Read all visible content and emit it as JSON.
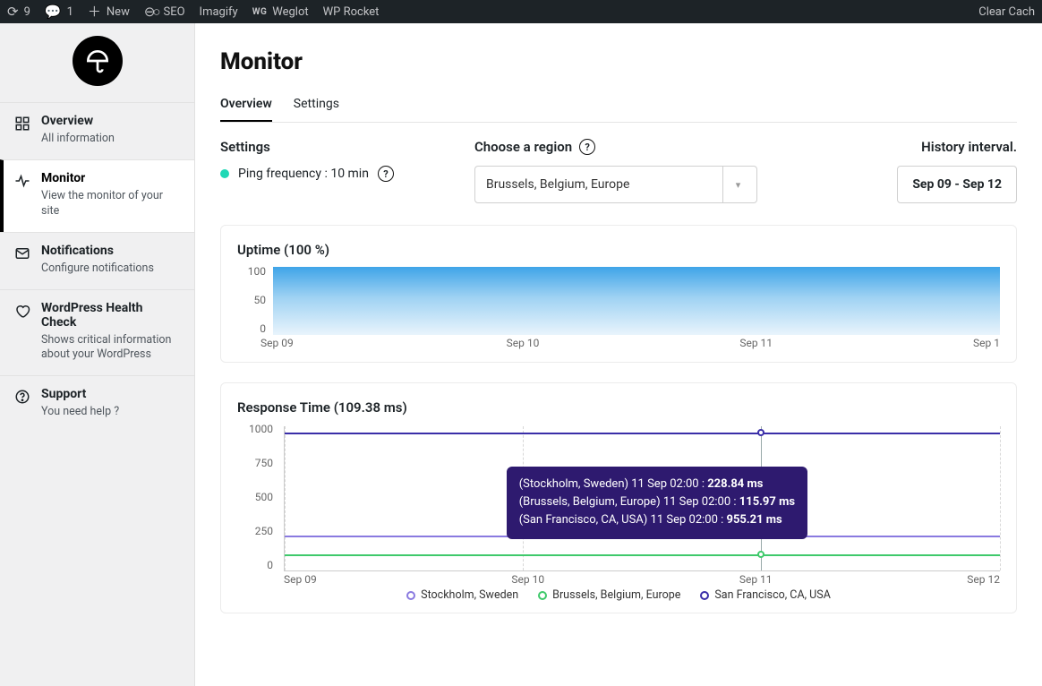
{
  "adminbar": {
    "updates_count": "9",
    "comments_count": "1",
    "new_label": "New",
    "items": [
      "SEO",
      "Imagify",
      "Weglot",
      "WP Rocket"
    ],
    "clear_cache": "Clear Cach"
  },
  "sidebar": {
    "items": [
      {
        "label": "Overview",
        "desc": "All information"
      },
      {
        "label": "Monitor",
        "desc": "View the monitor of your site"
      },
      {
        "label": "Notifications",
        "desc": "Configure notifications"
      },
      {
        "label": "WordPress Health Check",
        "desc": "Shows critical information about your WordPress"
      },
      {
        "label": "Support",
        "desc": "You need help ?"
      }
    ]
  },
  "page": {
    "title": "Monitor"
  },
  "tabs": {
    "overview": "Overview",
    "settings": "Settings"
  },
  "controls": {
    "settings_label": "Settings",
    "ping_text": "Ping frequency : 10 min",
    "region_label": "Choose a region",
    "region_value": "Brussels, Belgium, Europe",
    "history_label": "History interval.",
    "date_range": "Sep 09 - Sep 12"
  },
  "uptime": {
    "title": "Uptime (100 %)",
    "ylabels": [
      "100",
      "50",
      "0"
    ],
    "xlabels": [
      "Sep 09",
      "Sep 10",
      "Sep 11",
      "Sep 1"
    ]
  },
  "response": {
    "title": "Response Time (109.38 ms)",
    "ylabels": [
      "1000",
      "750",
      "500",
      "250",
      "0"
    ],
    "xlabels": [
      "Sep 09",
      "Sep 10",
      "Sep 11",
      "Sep 12"
    ],
    "legend": [
      "Stockholm, Sweden",
      "Brussels, Belgium, Europe",
      "San Francisco, CA, USA"
    ],
    "colors": {
      "stockholm": "#8a7ae0",
      "brussels": "#3fc96b",
      "sanfrancisco": "#3a2ea8"
    },
    "tooltip": {
      "l1_loc": "(Stockholm, Sweden) 11 Sep 02:00 : ",
      "l1_val": "228.84 ms",
      "l2_loc": "(Brussels, Belgium, Europe) 11 Sep 02:00 : ",
      "l2_val": "115.97 ms",
      "l3_loc": "(San Francisco, CA, USA) 11 Sep 02:00 : ",
      "l3_val": "955.21 ms"
    }
  },
  "chart_data": [
    {
      "type": "area",
      "title": "Uptime (100 %)",
      "x": [
        "Sep 09",
        "Sep 10",
        "Sep 11",
        "Sep 12"
      ],
      "values": [
        100,
        100,
        100,
        100
      ],
      "ylim": [
        0,
        100
      ],
      "ylabel": "%"
    },
    {
      "type": "line",
      "title": "Response Time (109.38 ms)",
      "x": [
        "Sep 09",
        "Sep 10",
        "Sep 11",
        "Sep 12"
      ],
      "ylim": [
        0,
        1000
      ],
      "ylabel": "ms",
      "series": [
        {
          "name": "Stockholm, Sweden",
          "color": "#8a7ae0",
          "values": [
            230,
            230,
            228.84,
            250
          ]
        },
        {
          "name": "Brussels, Belgium, Europe",
          "color": "#3fc96b",
          "values": [
            95,
            100,
            115.97,
            130
          ]
        },
        {
          "name": "San Francisco, CA, USA",
          "color": "#3a2ea8",
          "values": [
            960,
            955,
            955.21,
            950
          ]
        }
      ],
      "tooltip_sample": {
        "x": "11 Sep 02:00",
        "Stockholm, Sweden": 228.84,
        "Brussels, Belgium, Europe": 115.97,
        "San Francisco, CA, USA": 955.21
      }
    }
  ]
}
